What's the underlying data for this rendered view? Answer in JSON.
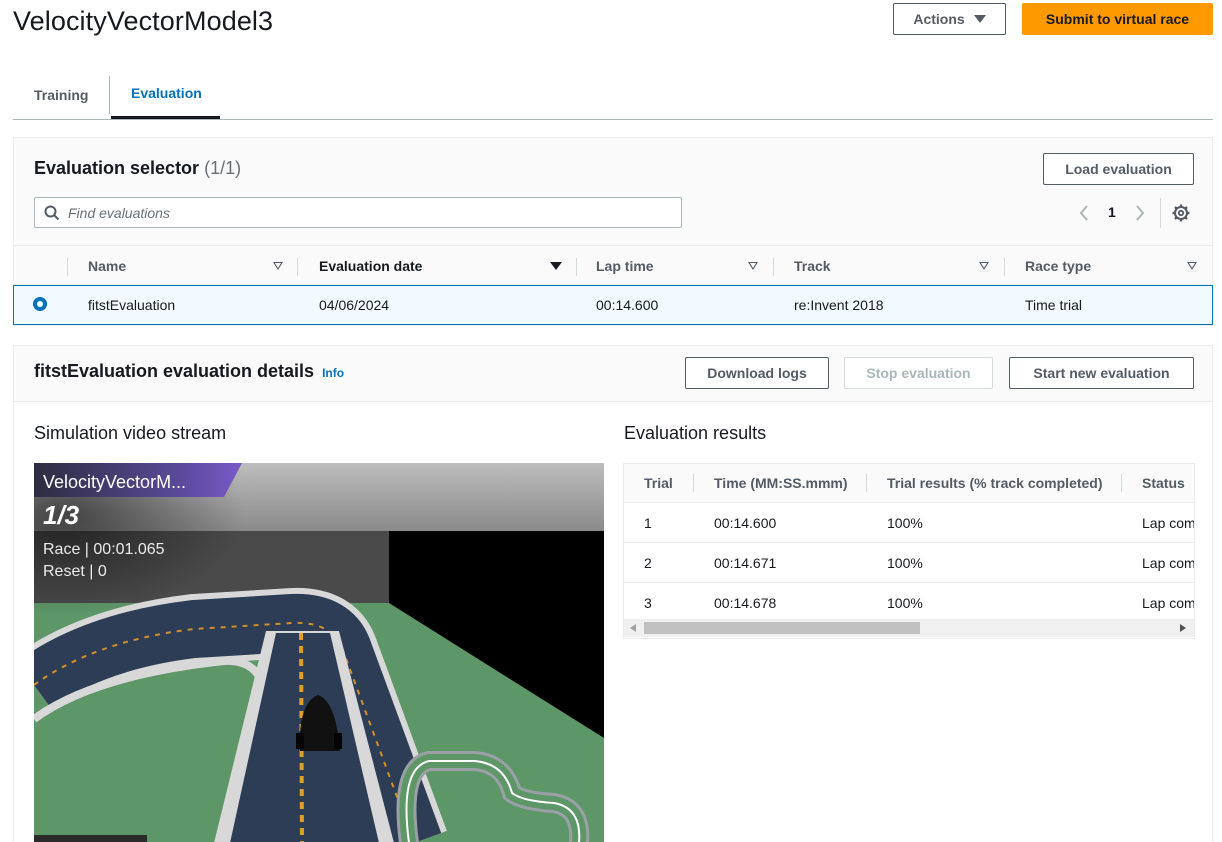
{
  "header": {
    "title": "VelocityVectorModel3",
    "actions_label": "Actions",
    "submit_label": "Submit to virtual race"
  },
  "tabs": [
    {
      "label": "Training",
      "active": false
    },
    {
      "label": "Evaluation",
      "active": true
    }
  ],
  "selector": {
    "title": "Evaluation selector",
    "count": "(1/1)",
    "load_label": "Load evaluation",
    "search_placeholder": "Find evaluations",
    "page": "1",
    "columns": [
      "Name",
      "Evaluation date",
      "Lap time",
      "Track",
      "Race type"
    ],
    "rows": [
      {
        "name": "fitstEvaluation",
        "date": "04/06/2024",
        "lap_time": "00:14.600",
        "track": "re:Invent 2018",
        "race_type": "Time trial",
        "selected": true
      }
    ]
  },
  "details": {
    "title": "fitstEvaluation evaluation details",
    "info_label": "Info",
    "download_label": "Download logs",
    "stop_label": "Stop evaluation",
    "start_label": "Start new evaluation",
    "video_title": "Simulation video stream",
    "video": {
      "model_name": "VelocityVectorM...",
      "lap": "1/3",
      "race": "Race | 00:01.065",
      "reset": "Reset | 0"
    },
    "results_title": "Evaluation results",
    "results_columns": [
      "Trial",
      "Time (MM:SS.mmm)",
      "Trial results (% track completed)",
      "Status"
    ],
    "results": [
      {
        "trial": "1",
        "time": "00:14.600",
        "pct": "100%",
        "status": "Lap com"
      },
      {
        "trial": "2",
        "time": "00:14.671",
        "pct": "100%",
        "status": "Lap com"
      },
      {
        "trial": "3",
        "time": "00:14.678",
        "pct": "100%",
        "status": "Lap com"
      }
    ],
    "scrollbar_position": 0.0
  },
  "colors": {
    "accent": "#0073bb",
    "primary": "#ff9900",
    "track_grass": "#5d9768",
    "video_banner": "#5a4a9a"
  }
}
